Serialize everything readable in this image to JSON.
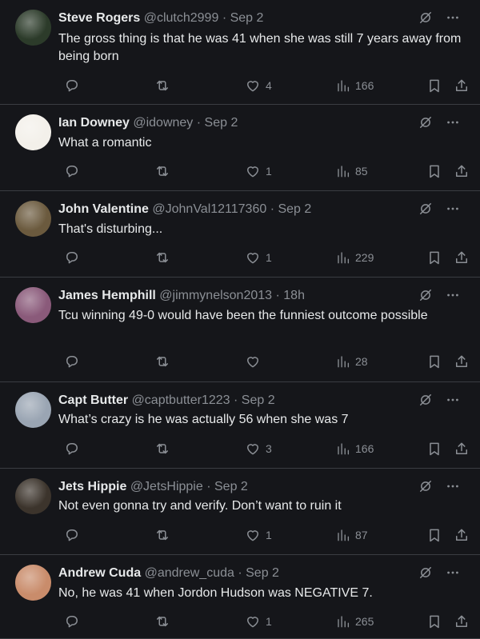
{
  "tweets": [
    {
      "name": "Steve Rogers",
      "handle": "@clutch2999",
      "dot": "·",
      "time": "Sep 2",
      "text": "The gross thing is that he was 41 when she was still 7 years away from being born",
      "likes": "4",
      "views": "166",
      "avatar_color": "#2c3b2a"
    },
    {
      "name": "Ian Downey",
      "handle": "@idowney",
      "dot": "·",
      "time": "Sep 2",
      "text": "What a romantic",
      "likes": "1",
      "views": "85",
      "avatar_color": "#f3f0ea"
    },
    {
      "name": "John Valentine",
      "handle": "@JohnVal12117360",
      "dot": "·",
      "time": "Sep 2",
      "text": "That's disturbing...",
      "likes": "1",
      "views": "229",
      "avatar_color": "#6b5a3e"
    },
    {
      "name": "James Hemphill",
      "handle": "@jimmynelson2013",
      "dot": "·",
      "time": "18h",
      "text": "Tcu winning 49-0 would have been the funniest outcome possible",
      "likes": "",
      "views": "28",
      "avatar_color": "#8a5a7a"
    },
    {
      "name": "Capt Butter",
      "handle": "@captbutter1223",
      "dot": "·",
      "time": "Sep 2",
      "text": "What’s crazy is he was actually 56 when she was 7",
      "likes": "3",
      "views": "166",
      "avatar_color": "#9aa5b3"
    },
    {
      "name": "Jets Hippie",
      "handle": "@JetsHippie",
      "dot": "·",
      "time": "Sep 2",
      "text": "Not even gonna try and verify. Don’t want to ruin it",
      "likes": "1",
      "views": "87",
      "avatar_color": "#3c342c"
    },
    {
      "name": "Andrew Cuda",
      "handle": "@andrew_cuda",
      "dot": "·",
      "time": "Sep 2",
      "text": "No, he was 41 when Jordon Hudson was NEGATIVE 7.",
      "likes": "1",
      "views": "265",
      "avatar_color": "#c98c6b"
    }
  ],
  "icons": {
    "reply": "reply-icon",
    "retweet": "retweet-icon",
    "like": "heart-icon",
    "views": "views-chart-icon",
    "bookmark": "bookmark-icon",
    "share": "share-icon",
    "grok": "grok-icon",
    "more": "more-icon"
  }
}
